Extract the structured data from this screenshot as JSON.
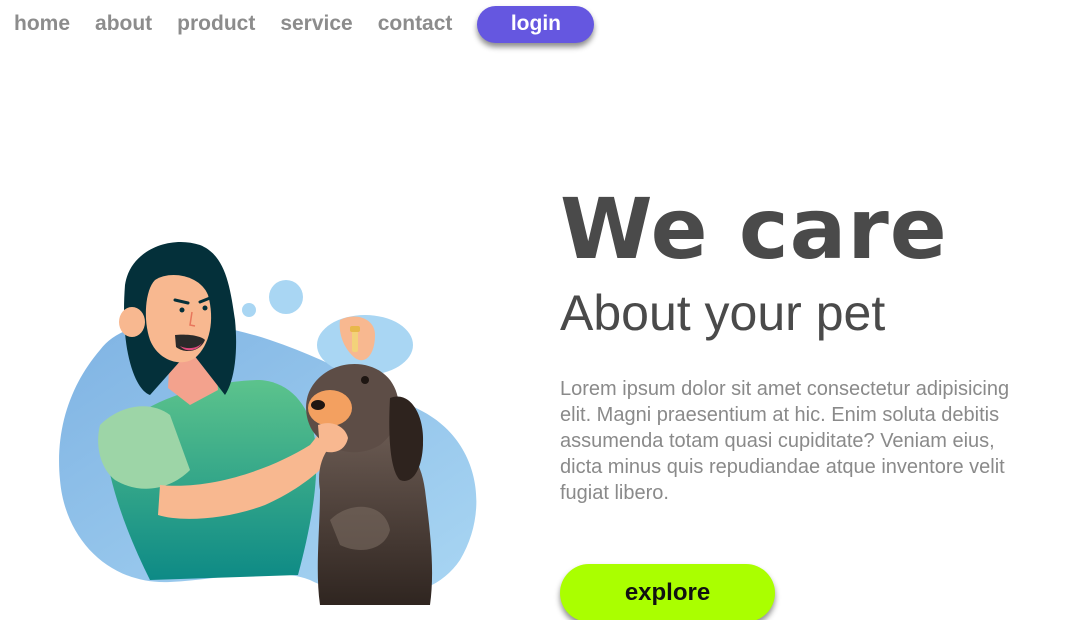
{
  "nav": {
    "links": [
      {
        "label": "home"
      },
      {
        "label": "about"
      },
      {
        "label": "product"
      },
      {
        "label": "service"
      },
      {
        "label": "contact"
      }
    ],
    "login_label": "login"
  },
  "hero": {
    "title": "We care",
    "subtitle": "About your pet",
    "body": "Lorem ipsum dolor sit amet consectetur adipisicing elit. Magni praesentium at hic. Enim soluta debitis assumenda totam quasi cupiditate? Veniam eius, dicta minus quis repudiandae atque inventore velit fugiat libero.",
    "explore_label": "explore"
  },
  "colors": {
    "nav_text": "#8c8c8c",
    "login_bg": "#6557e0",
    "heading_text": "#4a4a4a",
    "body_text": "#8a8a8a",
    "explore_bg": "#aaff00"
  },
  "illustration": {
    "icon": "woman-giving-dog-eye-drops-illustration"
  }
}
